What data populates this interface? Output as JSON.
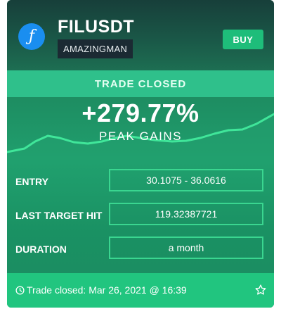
{
  "signal": {
    "pair": "FILUSDT",
    "trader": "AMAZINGMAN",
    "side": "BUY",
    "status": "TRADE CLOSED",
    "gain": "+279.77%",
    "gain_label": "PEAK GAINS"
  },
  "details": {
    "entry_label": "ENTRY",
    "entry_value": "30.1075 - 36.0616",
    "target_label": "LAST TARGET HIT",
    "target_value": "119.32387721",
    "duration_label": "DURATION",
    "duration_value": "a month"
  },
  "footer": {
    "text": "Trade closed: Mar 26, 2021 @ 16:39"
  },
  "icons": {
    "coin": "filecoin-logo",
    "clock": "clock-icon",
    "favorite": "star-outline-icon"
  },
  "colors": {
    "side_button": "#1ebd7a",
    "status_banner": "#2fc08b",
    "coin_logo": "#1a8ef0"
  }
}
